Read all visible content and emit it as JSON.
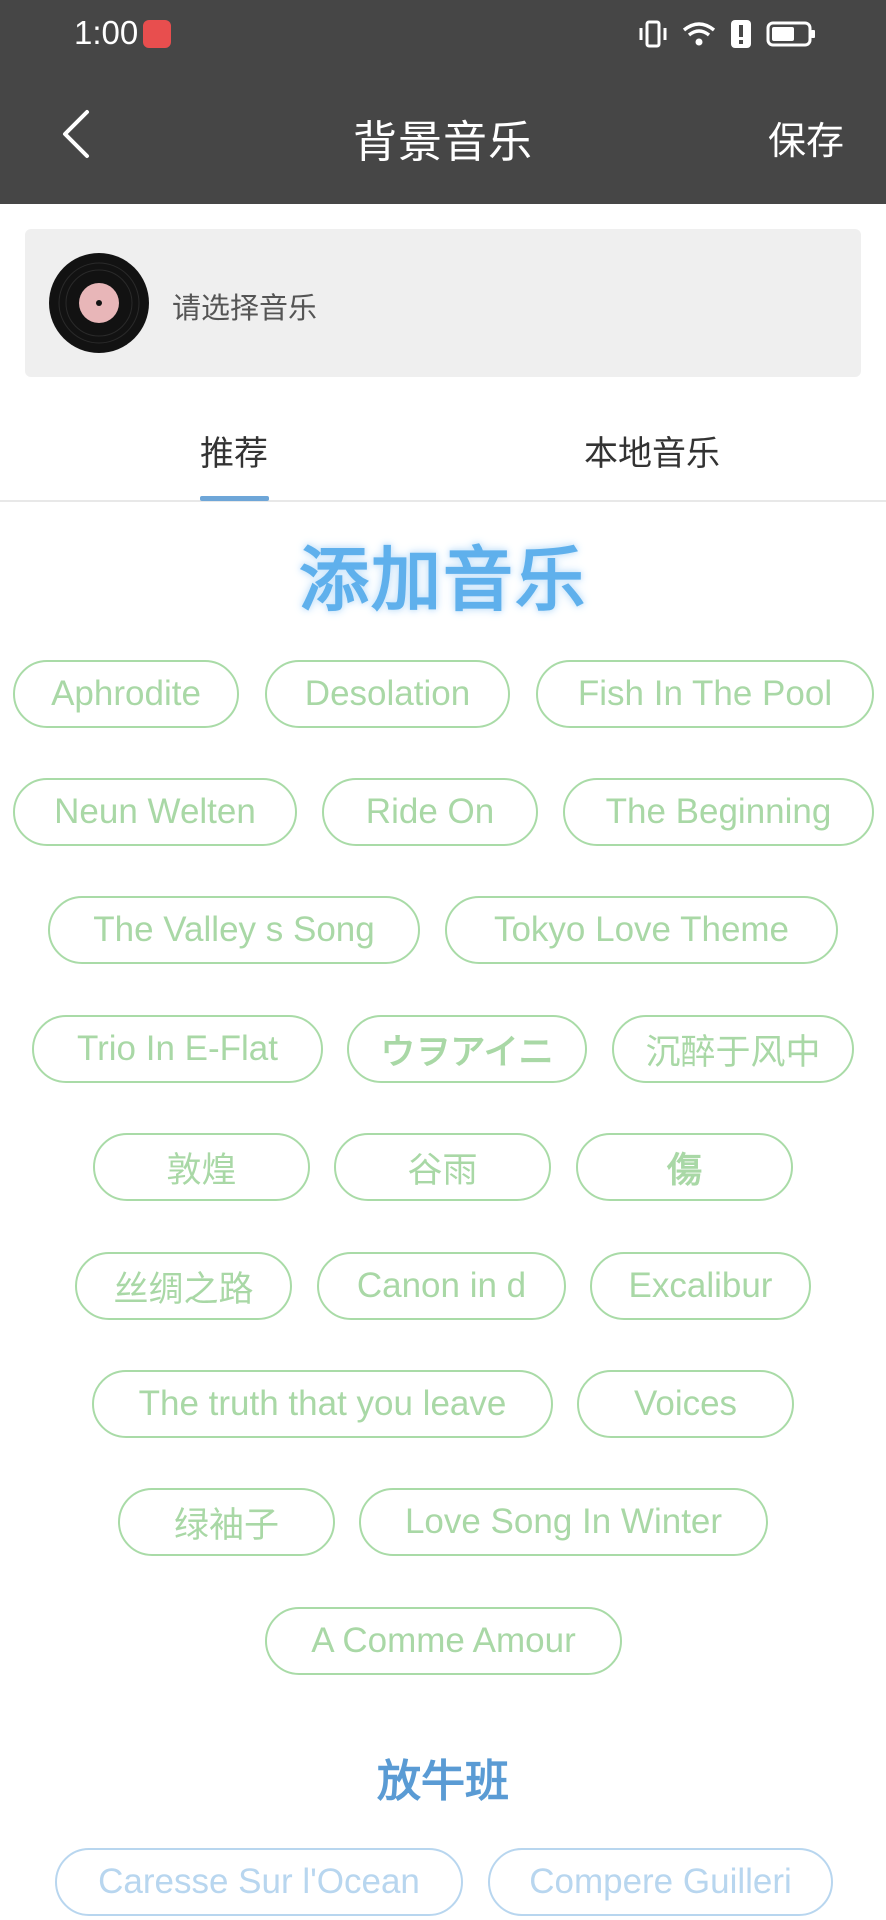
{
  "status": {
    "time": "1:00"
  },
  "header": {
    "title": "背景音乐",
    "save_label": "保存"
  },
  "music_card": {
    "label": "请选择音乐"
  },
  "tabs": [
    {
      "label": "推荐"
    },
    {
      "label": "本地音乐"
    }
  ],
  "section_main": {
    "title": "添加音乐",
    "tags": [
      "Aphrodite",
      "Desolation",
      "Fish In The Pool",
      "Neun Welten",
      "Ride On",
      "The Beginning",
      "The Valley s Song",
      "Tokyo Love Theme",
      "Trio In E-Flat",
      "ウヲアイニ",
      "沉醉于风中",
      "敦煌",
      "谷雨",
      "傷",
      "丝绸之路",
      "Canon in d",
      "Excalibur",
      "The truth that you leave",
      "Voices",
      "绿袖子",
      "Love Song In Winter",
      "A Comme Amour"
    ]
  },
  "section_second": {
    "title": "放牛班",
    "tags": [
      "Caresse Sur l'Ocean",
      "Compere Guilleri"
    ]
  }
}
